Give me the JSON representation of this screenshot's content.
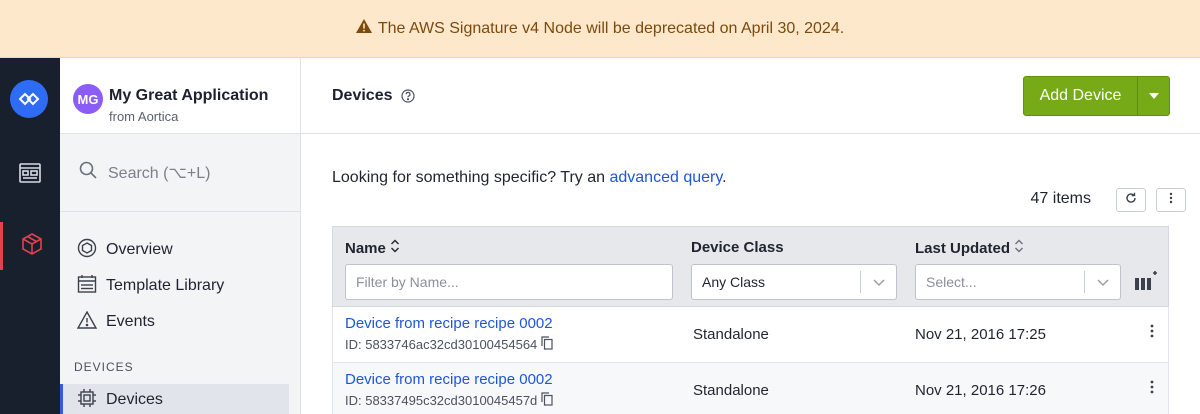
{
  "banner": {
    "text": "The AWS Signature v4 Node will be deprecated on April 30, 2024."
  },
  "app": {
    "initials": "MG",
    "name": "My Great Application",
    "org": "from Aortica"
  },
  "sidebar": {
    "search_placeholder": "Search (⌥+L)",
    "items": [
      {
        "label": "Overview",
        "icon": "overview-icon"
      },
      {
        "label": "Template Library",
        "icon": "template-library-icon"
      },
      {
        "label": "Events",
        "icon": "events-icon"
      }
    ],
    "section_label": "DEVICES",
    "active_item": {
      "label": "Devices",
      "icon": "chip-icon"
    }
  },
  "header": {
    "title": "Devices",
    "add_button": "Add Device"
  },
  "hint": {
    "prefix": "Looking for something specific? Try an ",
    "link": "advanced query",
    "suffix": "."
  },
  "items_count": "47 items",
  "table": {
    "columns": {
      "name": "Name",
      "device_class": "Device Class",
      "last_updated": "Last Updated"
    },
    "filters": {
      "name_placeholder": "Filter by Name...",
      "class_value": "Any Class",
      "updated_placeholder": "Select..."
    },
    "rows": [
      {
        "name": "Device from recipe recipe 0002",
        "id": "ID: 5833746ac32cd30100454564",
        "class": "Standalone",
        "updated": "Nov 21, 2016 17:25"
      },
      {
        "name": "Device from recipe recipe 0002",
        "id": "ID: 58337495c32cd3010045457d",
        "class": "Standalone",
        "updated": "Nov 21, 2016 17:26"
      }
    ]
  },
  "colors": {
    "banner_bg": "#fde8cc",
    "accent_green": "#76aa17",
    "link_blue": "#1f56d6",
    "rail_bg": "#18202e",
    "active_red": "#e0424e",
    "logo_blue": "#2f6cf5"
  }
}
